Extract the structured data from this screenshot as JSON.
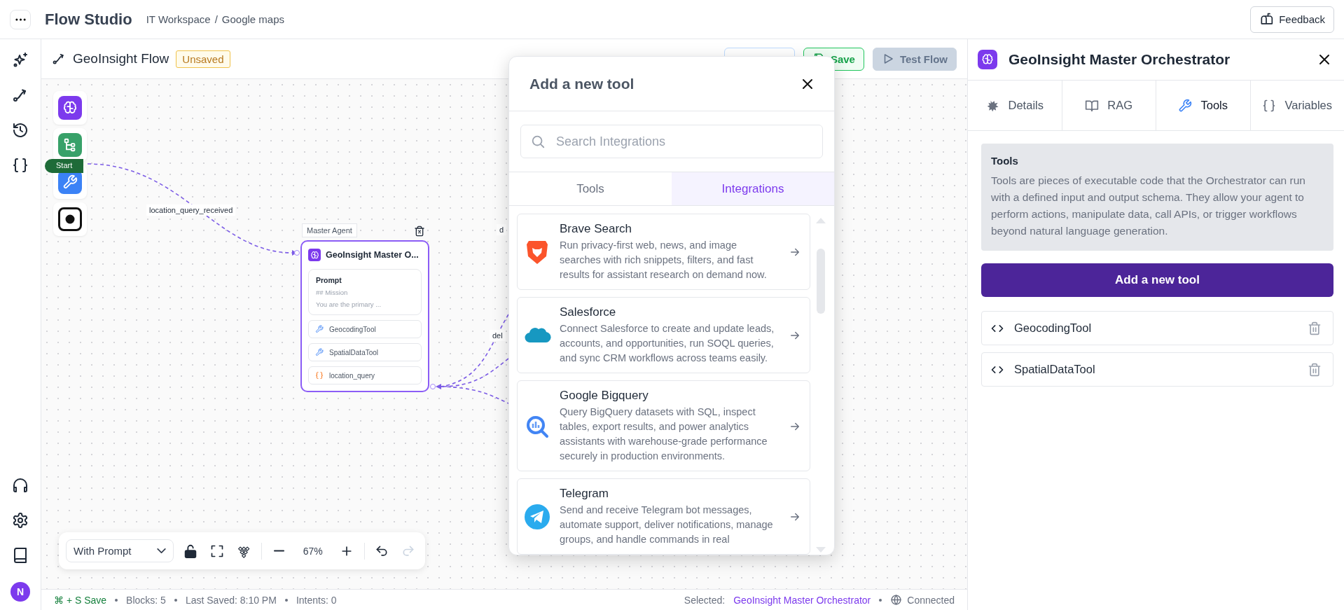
{
  "app": {
    "title": "Flow Studio",
    "breadcrumb": [
      "IT Workspace",
      "Google maps"
    ],
    "separator": "/",
    "feedback": "Feedback"
  },
  "rail": {
    "avatar": "N"
  },
  "flow": {
    "title": "GeoInsight Flow",
    "status": "Unsaved",
    "actions": [
      {
        "kind": "hidden"
      },
      {
        "kind": "save",
        "label": "Save",
        "disabled": false
      },
      {
        "kind": "test",
        "label": "Test Flow",
        "disabled": true
      }
    ]
  },
  "canvas": {
    "palette": [
      {
        "kind": "agent"
      },
      {
        "kind": "router"
      },
      {
        "kind": "tool"
      },
      {
        "kind": "end"
      }
    ],
    "start": "Start",
    "edge_labels": [
      "location_query_received",
      "d",
      "del"
    ],
    "node": {
      "tag": "Master Agent",
      "title": "GeoInsight Master O...",
      "prompt": {
        "heading": "Prompt",
        "lines": [
          "## Mission",
          "You are the primary ..."
        ]
      },
      "items": [
        {
          "kind": "tool",
          "label": "GeocodingTool"
        },
        {
          "kind": "tool",
          "label": "SpatialDataTool"
        },
        {
          "kind": "variable",
          "label": "location_query"
        }
      ]
    }
  },
  "controls": {
    "mode": "With Prompt",
    "zoom": "67%",
    "redo_disabled": true
  },
  "status_bar": {
    "shortcut": "⌘ + S Save",
    "items": [
      "Blocks: 5",
      "Last Saved: 8:10 PM",
      "Intents: 0"
    ],
    "selected_label": "Selected:",
    "selected": "GeoInsight Master Orchestrator",
    "connection": "Connected"
  },
  "modal": {
    "title": "Add a new tool",
    "search": {
      "placeholder": "Search Integrations"
    },
    "tabs": [
      {
        "label": "Tools",
        "selected": false
      },
      {
        "label": "Integrations",
        "selected": true
      }
    ],
    "integrations": [
      {
        "kind": "brave",
        "name": "Brave Search",
        "description": "Run privacy-first web, news, and image searches with rich snippets, filters, and fast results for assistant research on demand now."
      },
      {
        "kind": "salesforce",
        "name": "Salesforce",
        "description": "Connect Salesforce to create and update leads, accounts, and opportunities, run SOQL queries, and sync CRM workflows across teams easily."
      },
      {
        "kind": "bigquery",
        "name": "Google Bigquery",
        "description": "Query BigQuery datasets with SQL, inspect tables, export results, and power analytics assistants with warehouse-grade performance securely in production environments."
      },
      {
        "kind": "telegram",
        "name": "Telegram",
        "description": "Send and receive Telegram bot messages, automate support, deliver notifications, manage groups, and handle commands in real"
      }
    ]
  },
  "panel": {
    "title": "GeoInsight Master Orchestrator",
    "tabs": [
      {
        "kind": "details",
        "label": "Details",
        "selected": false
      },
      {
        "kind": "rag",
        "label": "RAG",
        "selected": false
      },
      {
        "kind": "tools",
        "label": "Tools",
        "selected": true
      },
      {
        "kind": "variables",
        "label": "Variables",
        "selected": false
      }
    ],
    "info": {
      "heading": "Tools",
      "text": "Tools are pieces of executable code that the Orchestrator can run with a defined input and output schema. They allow your agent to perform actions, manipulate data, call APIs, or trigger workflows beyond natural language generation."
    },
    "add_button": "Add a new tool",
    "tools": [
      {
        "name": "GeocodingTool"
      },
      {
        "name": "SpatialDataTool"
      }
    ]
  }
}
